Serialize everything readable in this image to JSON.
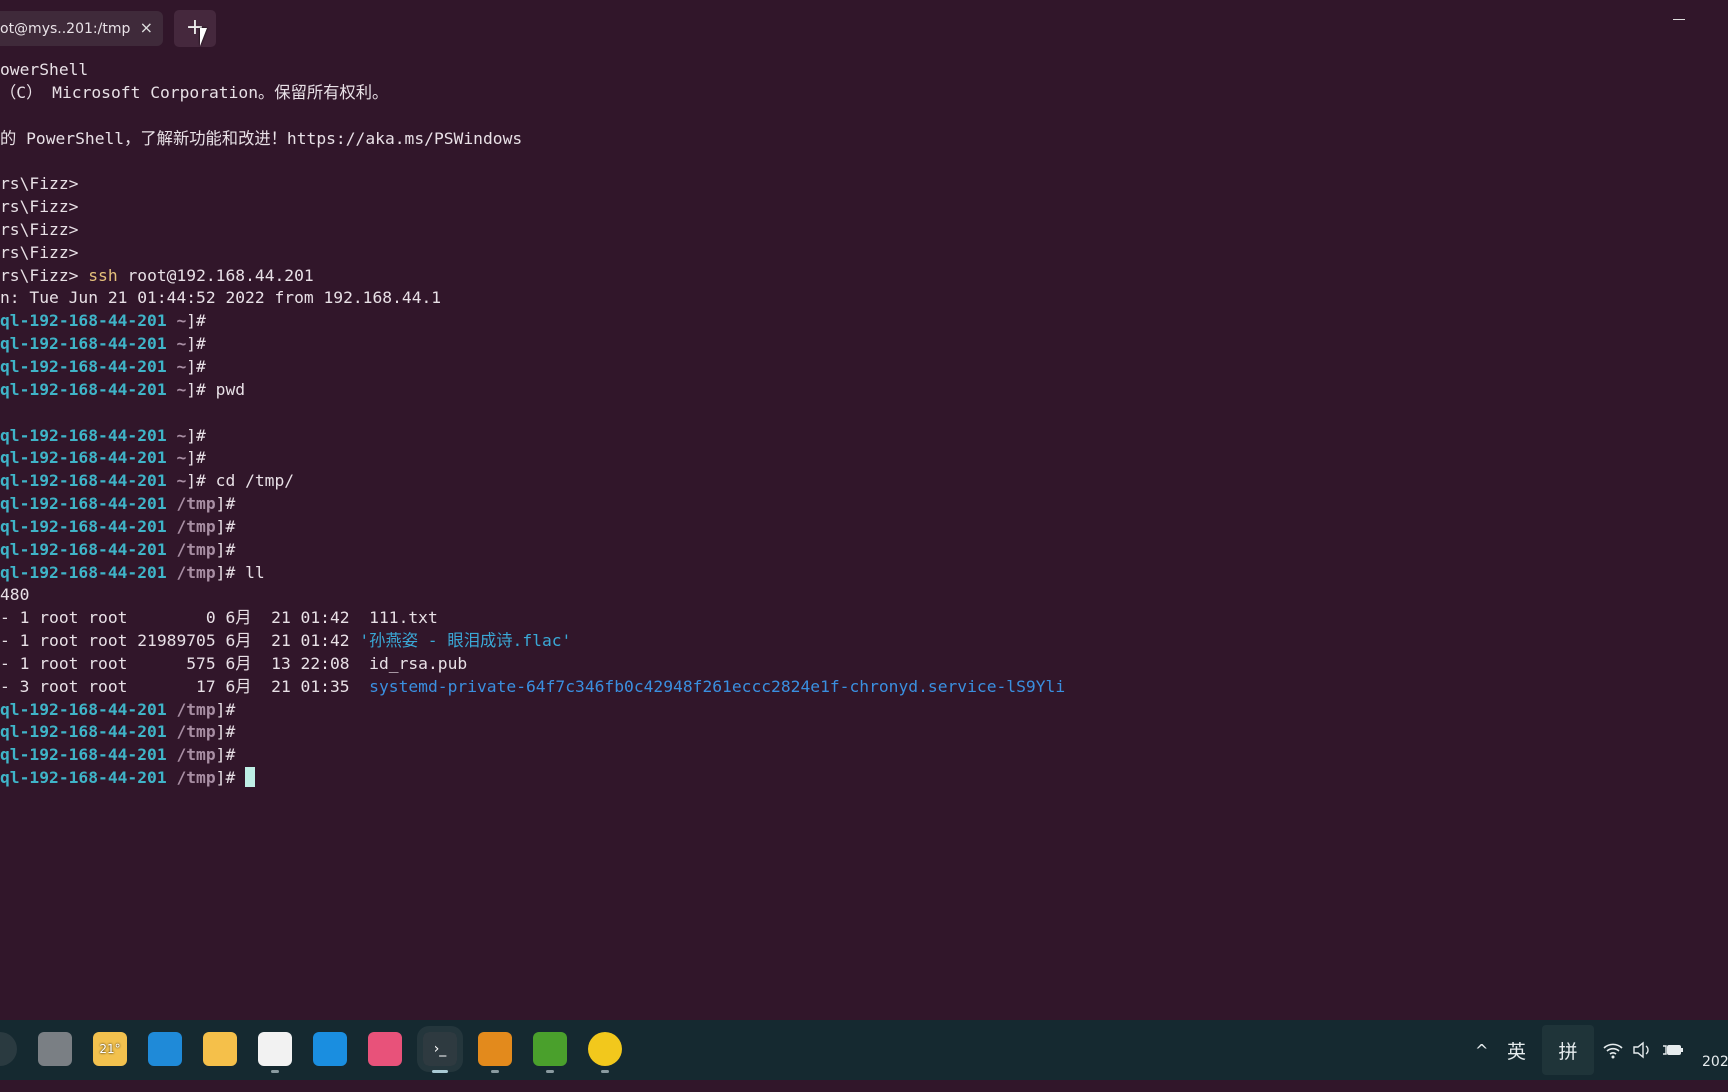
{
  "window": {
    "tab_title": "ot@mys..201:/tmp",
    "close_icon": "×",
    "new_tab_icon": "+"
  },
  "terminal": {
    "lines": [
      [
        {
          "t": "owerShell"
        }
      ],
      [
        {
          "t": "（C） Microsoft Corporation。保留所有权利。"
        }
      ],
      [],
      [
        {
          "t": "的 PowerShell，了解新功能和改进！https://aka.ms/PSWindows"
        }
      ],
      [],
      [
        {
          "t": "rs\\Fizz>"
        }
      ],
      [
        {
          "t": "rs\\Fizz>"
        }
      ],
      [
        {
          "t": "rs\\Fizz>"
        }
      ],
      [
        {
          "t": "rs\\Fizz>"
        }
      ],
      [
        {
          "t": "rs\\Fizz> "
        },
        {
          "t": "ssh",
          "c": "y"
        },
        {
          "t": " root@192.168.44.201"
        }
      ],
      [
        {
          "t": "n: Tue Jun 21 01:44:52 2022 from 192.168.44.1"
        }
      ],
      [
        {
          "t": "ql-192-168-44-201",
          "c": "p"
        },
        {
          "t": " ~",
          "c": "d"
        },
        {
          "t": "]#"
        }
      ],
      [
        {
          "t": "ql-192-168-44-201",
          "c": "p"
        },
        {
          "t": " ~",
          "c": "d"
        },
        {
          "t": "]#"
        }
      ],
      [
        {
          "t": "ql-192-168-44-201",
          "c": "p"
        },
        {
          "t": " ~",
          "c": "d"
        },
        {
          "t": "]#"
        }
      ],
      [
        {
          "t": "ql-192-168-44-201",
          "c": "p"
        },
        {
          "t": " ~",
          "c": "d"
        },
        {
          "t": "]# pwd"
        }
      ],
      [],
      [
        {
          "t": "ql-192-168-44-201",
          "c": "p"
        },
        {
          "t": " ~",
          "c": "d"
        },
        {
          "t": "]#"
        }
      ],
      [
        {
          "t": "ql-192-168-44-201",
          "c": "p"
        },
        {
          "t": " ~",
          "c": "d"
        },
        {
          "t": "]#"
        }
      ],
      [
        {
          "t": "ql-192-168-44-201",
          "c": "p"
        },
        {
          "t": " ~",
          "c": "d"
        },
        {
          "t": "]# cd /tmp/"
        }
      ],
      [
        {
          "t": "ql-192-168-44-201",
          "c": "p"
        },
        {
          "t": " /tmp",
          "c": "d"
        },
        {
          "t": "]#"
        }
      ],
      [
        {
          "t": "ql-192-168-44-201",
          "c": "p"
        },
        {
          "t": " /tmp",
          "c": "d"
        },
        {
          "t": "]#"
        }
      ],
      [
        {
          "t": "ql-192-168-44-201",
          "c": "p"
        },
        {
          "t": " /tmp",
          "c": "d"
        },
        {
          "t": "]#"
        }
      ],
      [
        {
          "t": "ql-192-168-44-201",
          "c": "p"
        },
        {
          "t": " /tmp",
          "c": "d"
        },
        {
          "t": "]# ll"
        }
      ],
      [
        {
          "t": "480"
        }
      ],
      [
        {
          "t": "- 1 root root        0 6月  21 01:42  111.txt"
        }
      ],
      [
        {
          "t": "- 1 root root 21989705 6月  21 01:42 "
        },
        {
          "t": "'孙燕姿 - 眼泪成诗.flac'",
          "c": "c"
        }
      ],
      [
        {
          "t": "- 1 root root      575 6月  13 22:08  id_rsa.pub"
        }
      ],
      [
        {
          "t": "- 3 root root       17 6月  21 01:35  "
        },
        {
          "t": "systemd-private-64f7c346fb0c42948f261eccc2824e1f-chronyd.service-lS9Yli",
          "c": "b"
        }
      ],
      [
        {
          "t": "ql-192-168-44-201",
          "c": "p"
        },
        {
          "t": " /tmp",
          "c": "d"
        },
        {
          "t": "]#"
        }
      ],
      [
        {
          "t": "ql-192-168-44-201",
          "c": "p"
        },
        {
          "t": " /tmp",
          "c": "d"
        },
        {
          "t": "]#"
        }
      ],
      [
        {
          "t": "ql-192-168-44-201",
          "c": "p"
        },
        {
          "t": " /tmp",
          "c": "d"
        },
        {
          "t": "]#"
        }
      ],
      [
        {
          "t": "ql-192-168-44-201",
          "c": "p"
        },
        {
          "t": " /tmp",
          "c": "d"
        },
        {
          "t": "]# "
        }
      ]
    ]
  },
  "taskbar": {
    "weather_temp": "21°",
    "apps": [
      {
        "name": "search",
        "icon": "search-icon",
        "color": "#2a3a40"
      },
      {
        "name": "task-view",
        "icon": "task-view-icon",
        "color": "#7a7f84"
      },
      {
        "name": "weather",
        "icon": "weather-icon",
        "color": "#f2c14e"
      },
      {
        "name": "edge",
        "icon": "edge-icon",
        "color": "#1f8ad8"
      },
      {
        "name": "file-explorer",
        "icon": "folder-icon",
        "color": "#f5c04a"
      },
      {
        "name": "store",
        "icon": "store-icon",
        "color": "#f2f2f2"
      },
      {
        "name": "mail",
        "icon": "mail-icon",
        "color": "#1a8ee0"
      },
      {
        "name": "photos",
        "icon": "photos-icon",
        "color": "#e8527a"
      },
      {
        "name": "terminal",
        "icon": "terminal-icon",
        "color": "#2e3a40"
      },
      {
        "name": "vmware",
        "icon": "vmware-icon",
        "color": "#e38a1c"
      },
      {
        "name": "camtasia",
        "icon": "camtasia-icon",
        "color": "#4aa02c"
      },
      {
        "name": "qq-music",
        "icon": "qq-music-icon",
        "color": "#f2c81c"
      }
    ],
    "terminal_glyph": "›_",
    "tray": {
      "chevron": "^",
      "ime_lang": "英",
      "ime_mode": "拼",
      "clock": "202"
    }
  },
  "colors": {
    "background": "#31162a",
    "prompt": "#3fb4c8",
    "taskbar": "#152930"
  }
}
